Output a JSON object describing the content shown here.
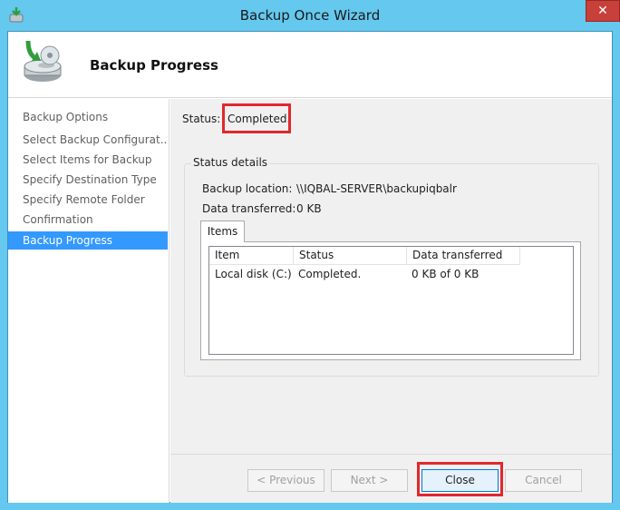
{
  "window": {
    "title": "Backup Once Wizard",
    "close_glyph": "✕"
  },
  "header": {
    "title": "Backup Progress"
  },
  "nav": {
    "items": [
      {
        "label": "Backup Options"
      },
      {
        "label": "Select Backup Configurat..."
      },
      {
        "label": "Select Items for Backup"
      },
      {
        "label": "Specify Destination Type"
      },
      {
        "label": "Specify Remote Folder"
      },
      {
        "label": "Confirmation"
      },
      {
        "label": "Backup Progress",
        "active": true
      }
    ]
  },
  "status": {
    "label": "Status:",
    "value": "Completed."
  },
  "details": {
    "group_label": "Status details",
    "backup_location_label": "Backup location:",
    "backup_location_value": "\\\\IQBAL-SERVER\\backupiqbalr",
    "data_transferred_label": "Data transferred:",
    "data_transferred_value": "0 KB"
  },
  "items_tab": {
    "label": "Items",
    "columns": [
      "Item",
      "Status",
      "Data transferred"
    ],
    "rows": [
      [
        "Local disk (C:)",
        "Completed.",
        "0 KB of 0 KB"
      ]
    ]
  },
  "buttons": {
    "previous": "< Previous",
    "next": "Next >",
    "close": "Close",
    "cancel": "Cancel"
  },
  "colors": {
    "title_bar": "#65c8ee",
    "selected_nav": "#3399ff",
    "highlight_box": "#e0282e"
  },
  "icons": {
    "app": "backup-app-icon",
    "header": "backup-disk-icon"
  }
}
